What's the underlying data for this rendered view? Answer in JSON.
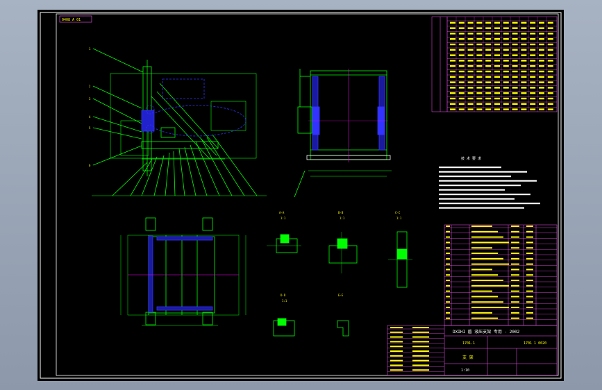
{
  "drawing": {
    "top_left_tag": "0408 A 01",
    "section_labels": [
      "1:1",
      "1:1",
      "1:1",
      "1:1"
    ],
    "tech_title": "技 术 要 求",
    "tech_notes": [
      "1.",
      "2.",
      "3.",
      "4.",
      "5.",
      "6."
    ],
    "title_block": {
      "company": "DXIHI 盾 液压支架 专用 - 2002",
      "part_no": "1701.1",
      "drawing_no": "1701 1 0020",
      "name": "支 架",
      "scale": "1:10"
    }
  },
  "colors": {
    "sheet": "#000000",
    "border": "#ffffff",
    "table": "#ff55ff",
    "text": "#ffff00",
    "geometry": "#00ff00",
    "hidden": "#3333ff",
    "centerline": "#ff00ff"
  }
}
